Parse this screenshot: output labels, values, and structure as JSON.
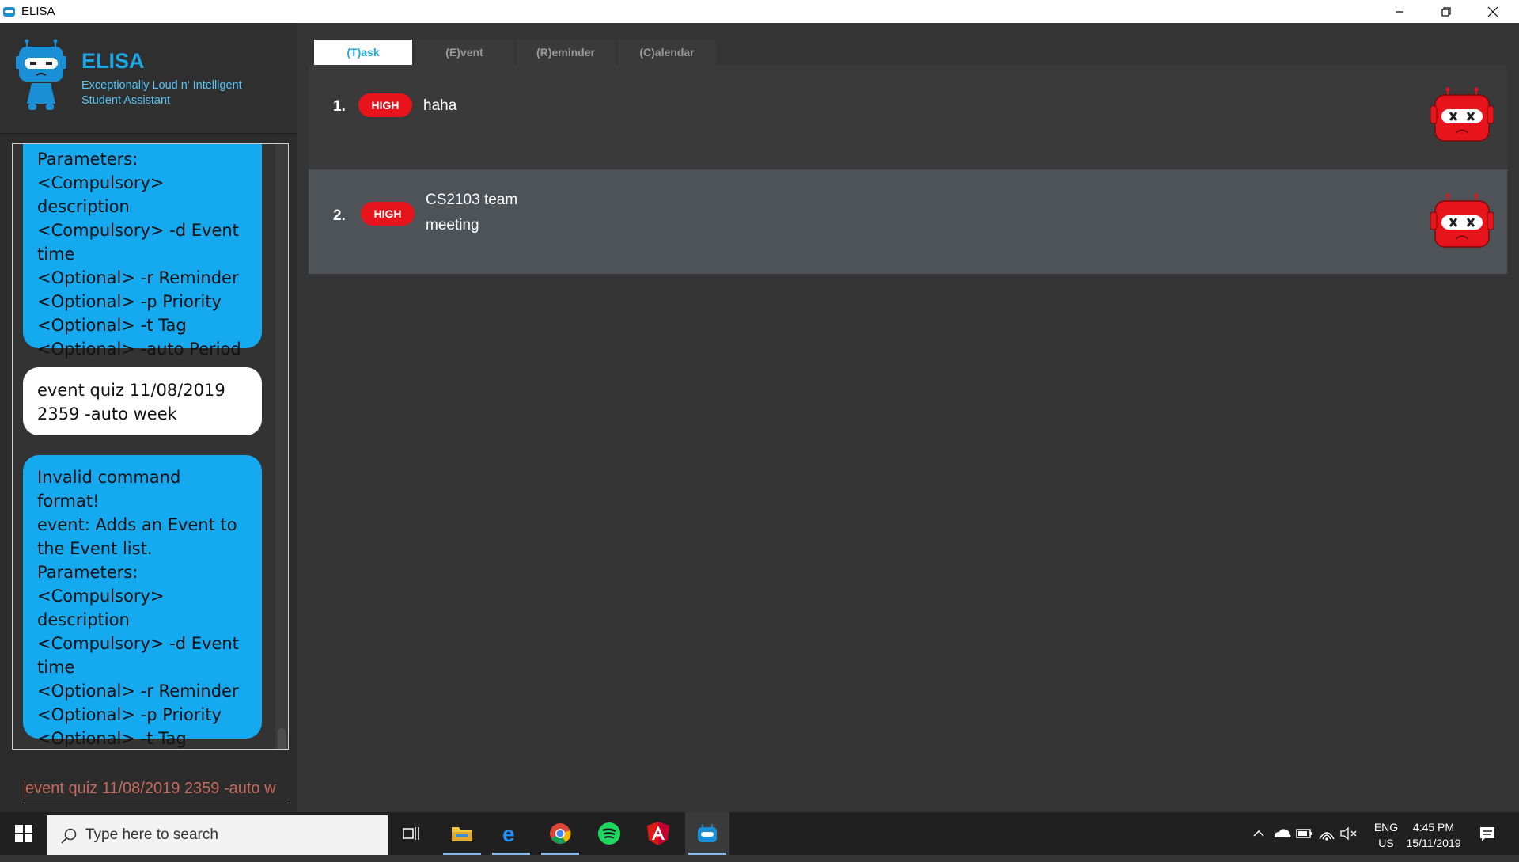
{
  "window": {
    "title": "ELISA"
  },
  "header": {
    "app_name": "ELISA",
    "tagline": "Exceptionally Loud n' Intelligent Student Assistant"
  },
  "chat": {
    "messages": [
      {
        "role": "bot",
        "text": "Parameters:\n<Compulsory> description\n<Compulsory> -d Event time\n<Optional> -r Reminder\n<Optional> -p Priority\n<Optional> -t Tag\n<Optional> -auto Period"
      },
      {
        "role": "user",
        "text": "event quiz 11/08/2019 2359 -auto week"
      },
      {
        "role": "bot",
        "text": "Invalid command format!\nevent: Adds an Event to the Event list.\nParameters:\n<Compulsory> description\n<Compulsory> -d Event time\n<Optional> -r Reminder\n<Optional> -p Priority\n<Optional> -t Tag\n<Optional> -auto Period"
      }
    ]
  },
  "command_box": {
    "value": "event quiz 11/08/2019 2359 -auto w"
  },
  "tabs": [
    {
      "label": "(T)ask",
      "active": true
    },
    {
      "label": "(E)vent",
      "active": false
    },
    {
      "label": "(R)eminder",
      "active": false
    },
    {
      "label": "(C)alendar",
      "active": false
    }
  ],
  "tasks": [
    {
      "index": "1.",
      "priority": "HIGH",
      "description": "haha",
      "status_icon": "sad-robot-icon"
    },
    {
      "index": "2.",
      "priority": "HIGH",
      "description": "CS2103 team meeting",
      "status_icon": "sad-robot-icon"
    }
  ],
  "taskbar": {
    "search_placeholder": "Type here to search",
    "language": "ENG",
    "region": "US",
    "time": "4:45 PM",
    "date": "15/11/2019"
  },
  "colors": {
    "accent": "#1aa8e6",
    "bot_bubble": "#15a9ef",
    "priority_high": "#e8141b",
    "background": "#353535"
  }
}
